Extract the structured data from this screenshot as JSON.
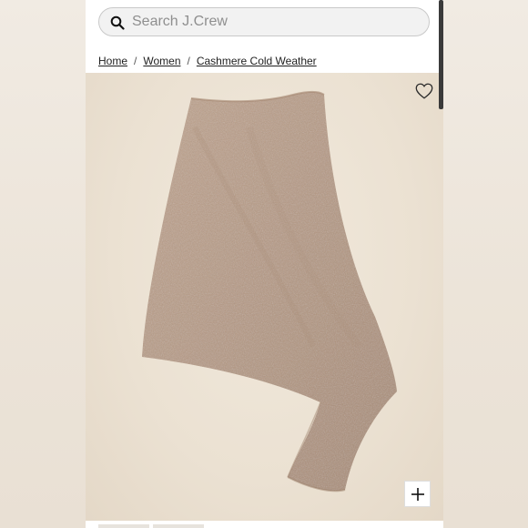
{
  "search": {
    "placeholder": "Search J.Crew",
    "value": ""
  },
  "breadcrumb": {
    "items": [
      {
        "label": "Home"
      },
      {
        "label": "Women"
      },
      {
        "label": "Cashmere Cold Weather"
      }
    ],
    "separator": "/"
  },
  "product": {
    "image": "cashmere-poncho",
    "color": "#b89c85"
  },
  "icons": {
    "search": "search-icon",
    "favorite": "heart-icon",
    "zoom": "plus-icon"
  }
}
